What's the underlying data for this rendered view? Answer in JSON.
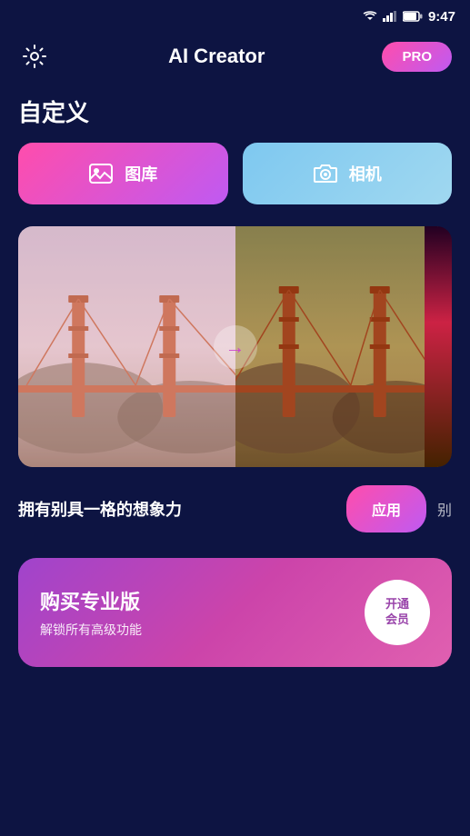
{
  "statusBar": {
    "time": "9:47"
  },
  "header": {
    "title": "AI Creator",
    "proLabel": "PRO",
    "settingsIcon": "gear-icon"
  },
  "sectionTitle": "自定义",
  "buttons": {
    "galleryLabel": "图库",
    "cameraLabel": "相机",
    "galleryIcon": "image-icon",
    "cameraIcon": "camera-icon"
  },
  "applyBar": {
    "text": "拥有别具一格的想象力",
    "applyLabel": "应用",
    "nextLabel": "别"
  },
  "proCard": {
    "title": "购买专业版",
    "subtitle": "解锁所有高级功能",
    "buttonLine1": "开通",
    "buttonLine2": "会员"
  },
  "arrowSymbol": "→",
  "colors": {
    "background": "#0d1442",
    "primaryGradientStart": "#ff4dac",
    "primaryGradientEnd": "#bf5af2",
    "cameraGradientStart": "#7ec8f0",
    "cameraGradientEnd": "#a0d8f0"
  }
}
